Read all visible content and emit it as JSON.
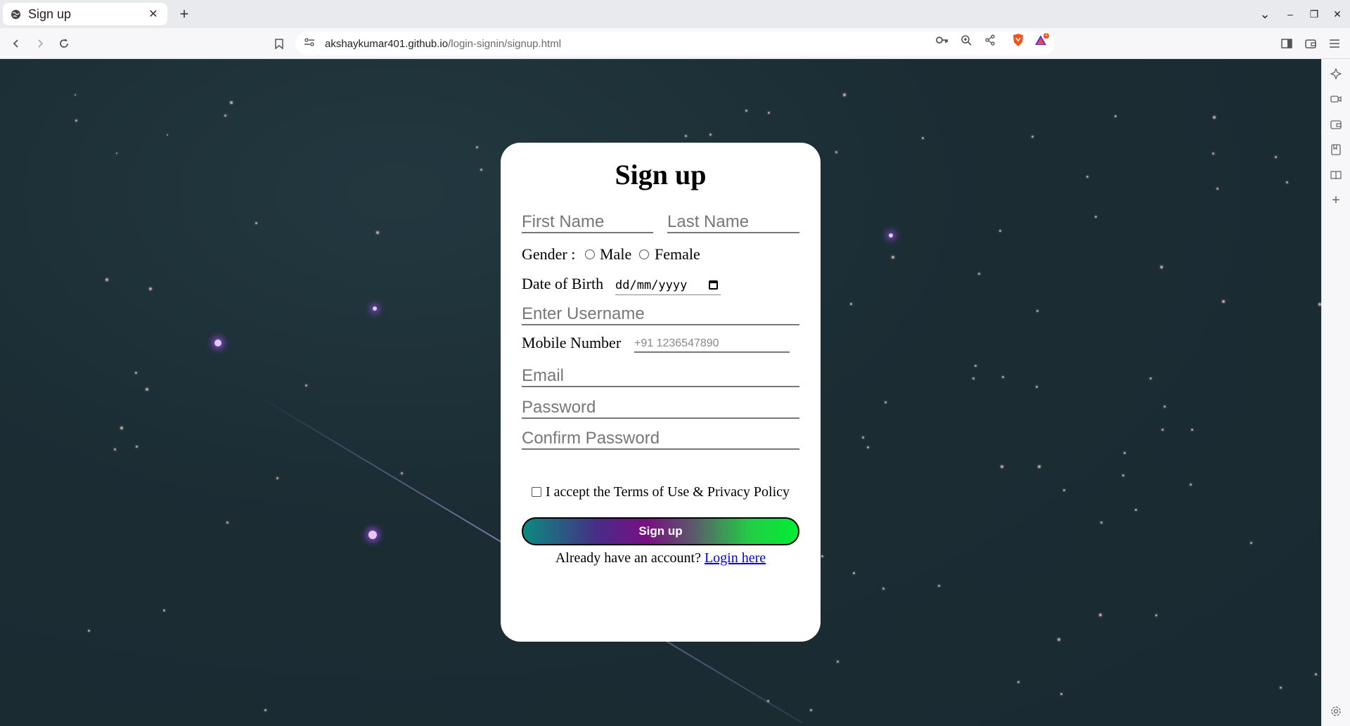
{
  "browser": {
    "tab": {
      "title": "Sign up",
      "close_glyph": "✕",
      "favicon": "globe-icon"
    },
    "new_tab_glyph": "+",
    "url": {
      "host": "akshaykumar401.github.io",
      "path": "/login-signin/signup.html"
    },
    "alert_badge_count": "1",
    "window_controls": {
      "dropdown": "⌄",
      "minimize": "–",
      "restore": "❐",
      "close": "✕"
    }
  },
  "form": {
    "title": "Sign up",
    "first_name_placeholder": "First Name",
    "last_name_placeholder": "Last Name",
    "gender_label": "Gender :",
    "gender_options": [
      "Male",
      "Female"
    ],
    "dob_label": "Date of Birth",
    "dob_placeholder": "dd/mm/yyyy",
    "username_placeholder": "Enter Username",
    "mobile_label": "Mobile Number",
    "mobile_placeholder": "+91 1236547890",
    "email_placeholder": "Email",
    "password_placeholder": "Password",
    "confirm_password_placeholder": "Confirm Password",
    "terms_text": "I accept the Terms of Use & Privacy Policy",
    "submit_label": "Sign up",
    "login_prompt": "Already have an account?",
    "login_link": "Login here"
  },
  "colors": {
    "background": "#1b2c33",
    "card": "#ffffff",
    "link": "#0000ee",
    "button_gradient": [
      "#0b8a80",
      "#7a0f84",
      "#00ee33"
    ]
  }
}
